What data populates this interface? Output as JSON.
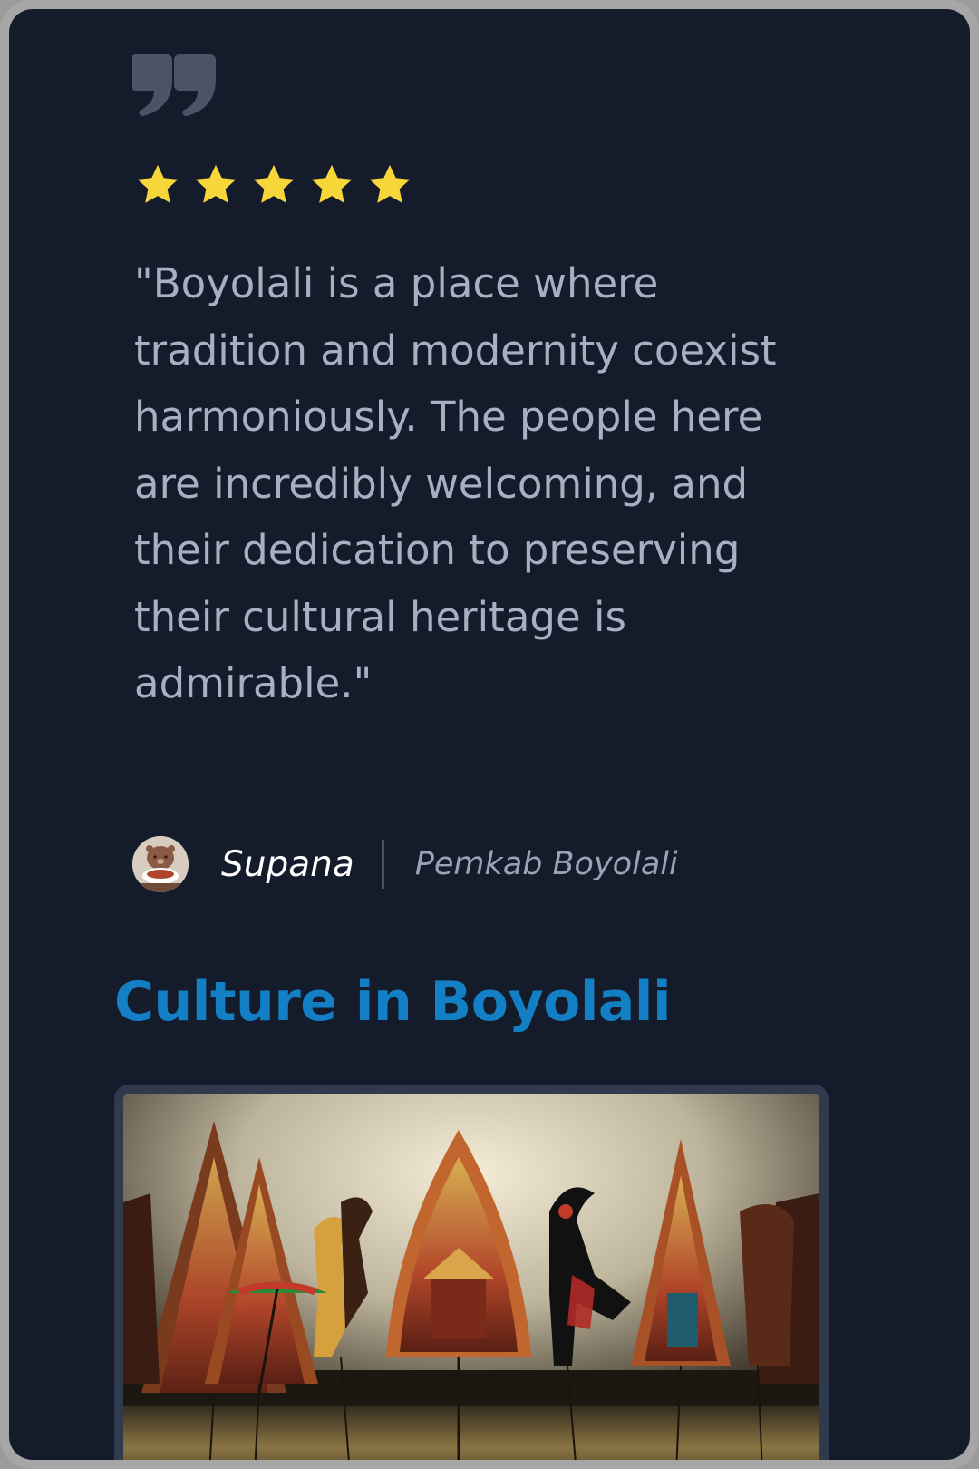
{
  "testimonial": {
    "quote_icon": "quote-icon",
    "rating": 5,
    "rating_max": 5,
    "star_color": "#f7d63a",
    "text": "\"Boyolali is a place where tradition and modernity coexist harmoniously. The people here are incredibly welcoming, and their dedication to preserving their cultural heritage is admirable.\"",
    "author": {
      "avatar_icon": "avatar",
      "name": "Supana",
      "organization": "Pemkab Boyolali"
    }
  },
  "culture": {
    "title": "Culture in Boyolali",
    "title_color": "#1380c6",
    "image_icon": "wayang-puppets-photo"
  }
}
